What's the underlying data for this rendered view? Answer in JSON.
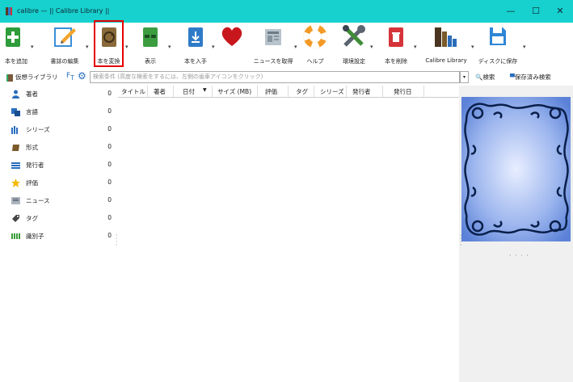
{
  "window": {
    "title": "calibre — || Calibre Library ||",
    "controls": [
      "—",
      "☐",
      "✕"
    ]
  },
  "toolbar": {
    "add_books": "本を追加",
    "edit_metadata": "書誌の編集",
    "convert_books": "本を変換",
    "view": "表示",
    "get_books": "本を入手",
    "fetch_news": "ニュースを取得",
    "help": "ヘルプ",
    "preferences": "環境設定",
    "remove_books": "本を削除",
    "library": "Calibre Library",
    "save_to_disk": "ディスクに保存"
  },
  "search": {
    "virtual_library": "仮想ライブラリ",
    "placeholder": "検索条件 (高度な検索をするには、左側の歯車アイコンをクリック)",
    "search_button": "検索",
    "saved_searches": "保存済み検索"
  },
  "sidebar": {
    "items": [
      {
        "label": "著者",
        "count": "0",
        "icon": "person-icon"
      },
      {
        "label": "言語",
        "count": "0",
        "icon": "language-icon"
      },
      {
        "label": "シリーズ",
        "count": "0",
        "icon": "series-icon"
      },
      {
        "label": "形式",
        "count": "0",
        "icon": "format-icon"
      },
      {
        "label": "発行者",
        "count": "0",
        "icon": "publisher-icon"
      },
      {
        "label": "評価",
        "count": "0",
        "icon": "rating-icon"
      },
      {
        "label": "ニュース",
        "count": "0",
        "icon": "news-icon"
      },
      {
        "label": "タグ",
        "count": "0",
        "icon": "tag-icon"
      },
      {
        "label": "識別子",
        "count": "0",
        "icon": "identifier-icon"
      }
    ]
  },
  "table": {
    "columns": [
      "タイトル",
      "著者",
      "日付",
      "サイズ (MB)",
      "評価",
      "タグ",
      "シリーズ",
      "発行者",
      "発行日"
    ]
  },
  "colors": {
    "titlebar": "#16d1cd",
    "highlight": "#e50000"
  }
}
